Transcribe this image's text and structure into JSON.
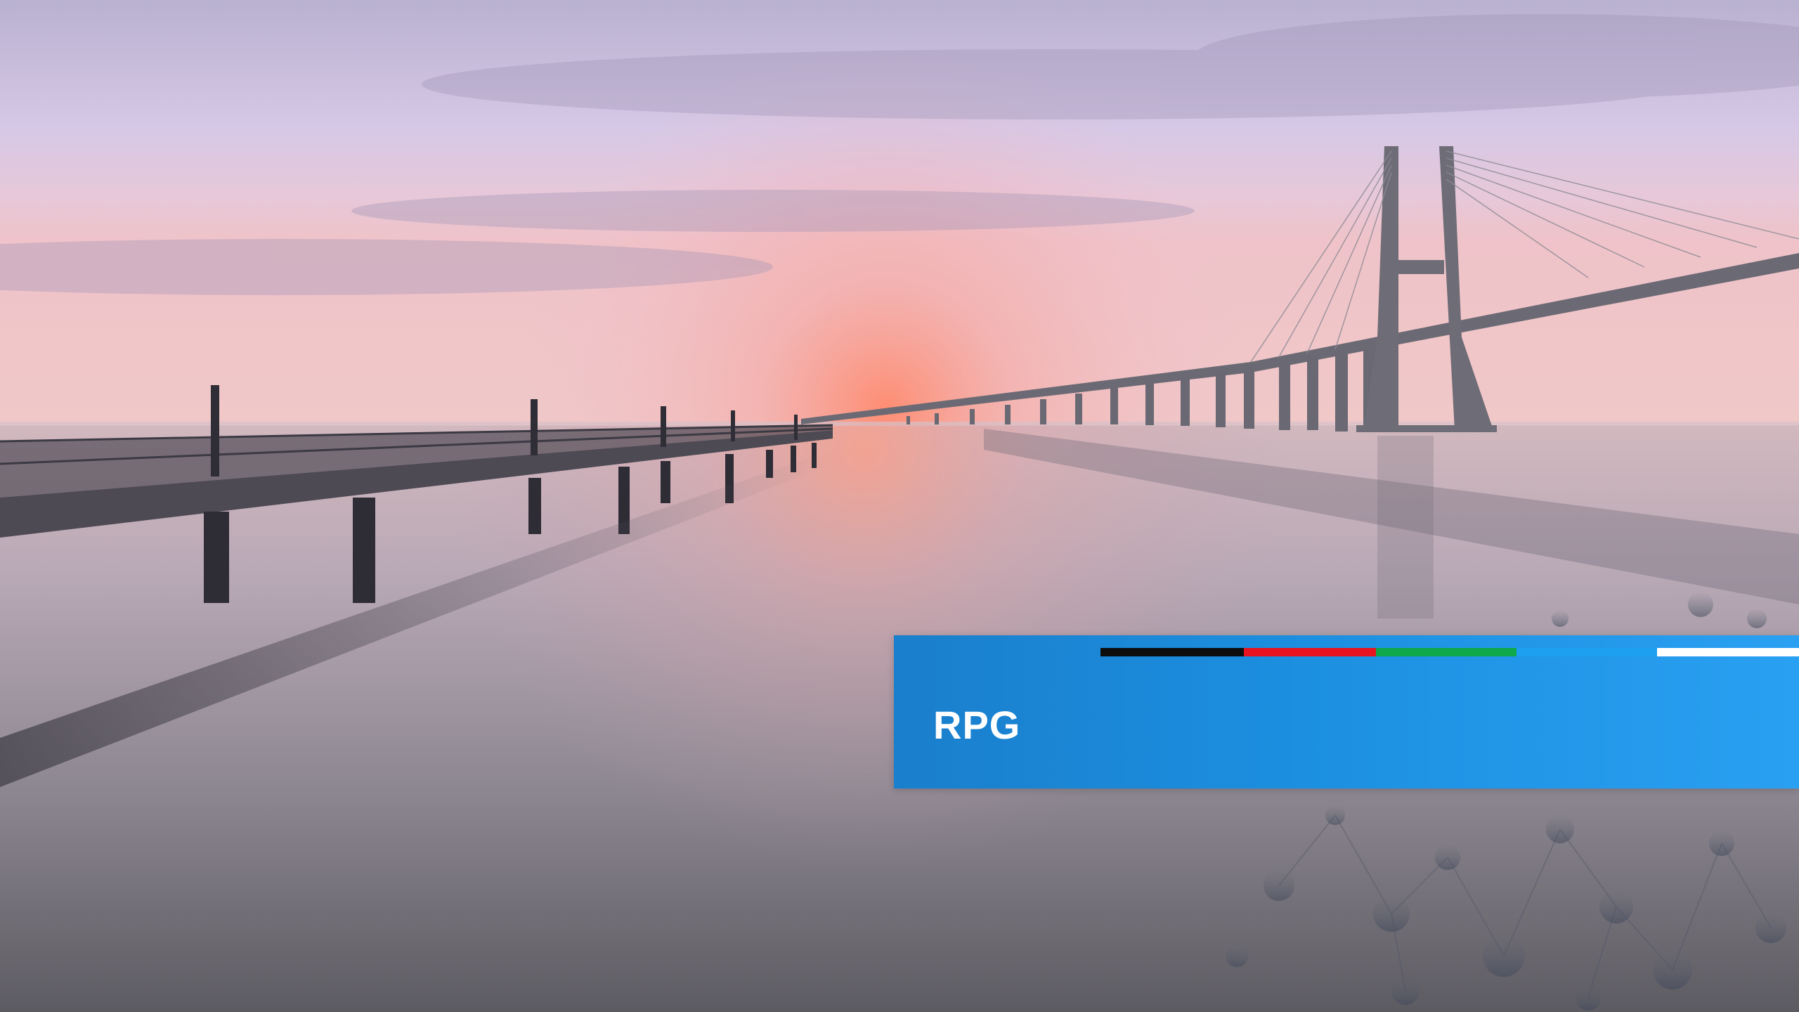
{
  "slide": {
    "title": "RPG",
    "banner_color": "#1c8fe0",
    "stripe_colors": [
      "#0d0d0d",
      "#e8131f",
      "#0fa84a",
      "#1da0f0",
      "#ffffff"
    ]
  }
}
